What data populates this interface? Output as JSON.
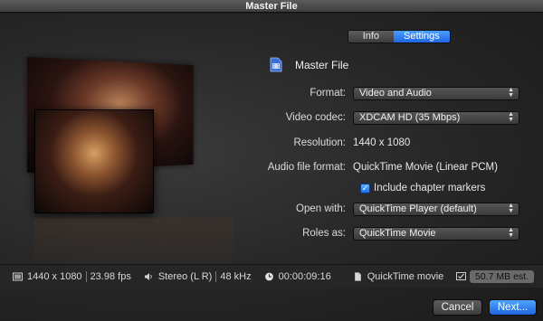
{
  "window": {
    "title": "Master File"
  },
  "tabs": [
    {
      "label": "Info",
      "active": false
    },
    {
      "label": "Settings",
      "active": true
    }
  ],
  "settings": {
    "header_title": "Master File",
    "format": {
      "label": "Format:",
      "value": "Video and Audio"
    },
    "video_codec": {
      "label": "Video codec:",
      "value": "XDCAM HD (35 Mbps)"
    },
    "resolution": {
      "label": "Resolution:",
      "value": "1440 x 1080"
    },
    "audio_format": {
      "label": "Audio file format:",
      "value": "QuickTime Movie (Linear PCM)"
    },
    "chapter_markers": {
      "label": "Include chapter markers",
      "checked": true
    },
    "open_with": {
      "label": "Open with:",
      "value": "QuickTime Player (default)"
    },
    "roles_as": {
      "label": "Roles as:",
      "value": "QuickTime Movie"
    }
  },
  "info_bar": {
    "resolution": "1440 x 1080",
    "fps": "23.98 fps",
    "audio": "Stereo (L R)",
    "sample_rate": "48 kHz",
    "duration": "00:00:09:16",
    "file_type": "QuickTime movie",
    "size": "50.7 MB est."
  },
  "buttons": {
    "cancel": "Cancel",
    "next": "Next..."
  },
  "colors": {
    "accent": "#2f7ff0",
    "background": "#262626"
  }
}
